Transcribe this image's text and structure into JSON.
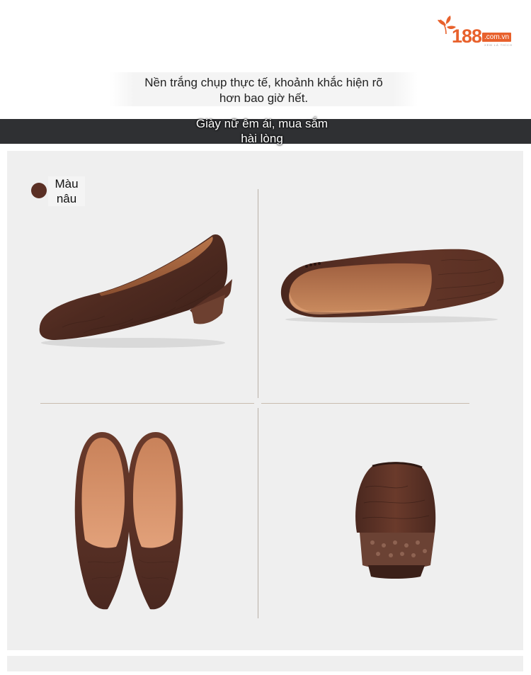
{
  "logo": {
    "number": "188",
    "domain": ".com.vn",
    "tagline": "XEM LÀ THÍCH",
    "color": "#e8612c"
  },
  "caption": {
    "line1": "Nền trắng chụp thực tế, khoảnh khắc hiện rõ",
    "line2": "hơn bao giờ hết."
  },
  "banner": {
    "line1": "Giày nữ êm ái, mua sắm",
    "line2": "hài lòng",
    "background": "#2f3033"
  },
  "product": {
    "color_name_line1": "Màu",
    "color_name_line2": "nâu",
    "color_hex": "#5a2f24"
  }
}
